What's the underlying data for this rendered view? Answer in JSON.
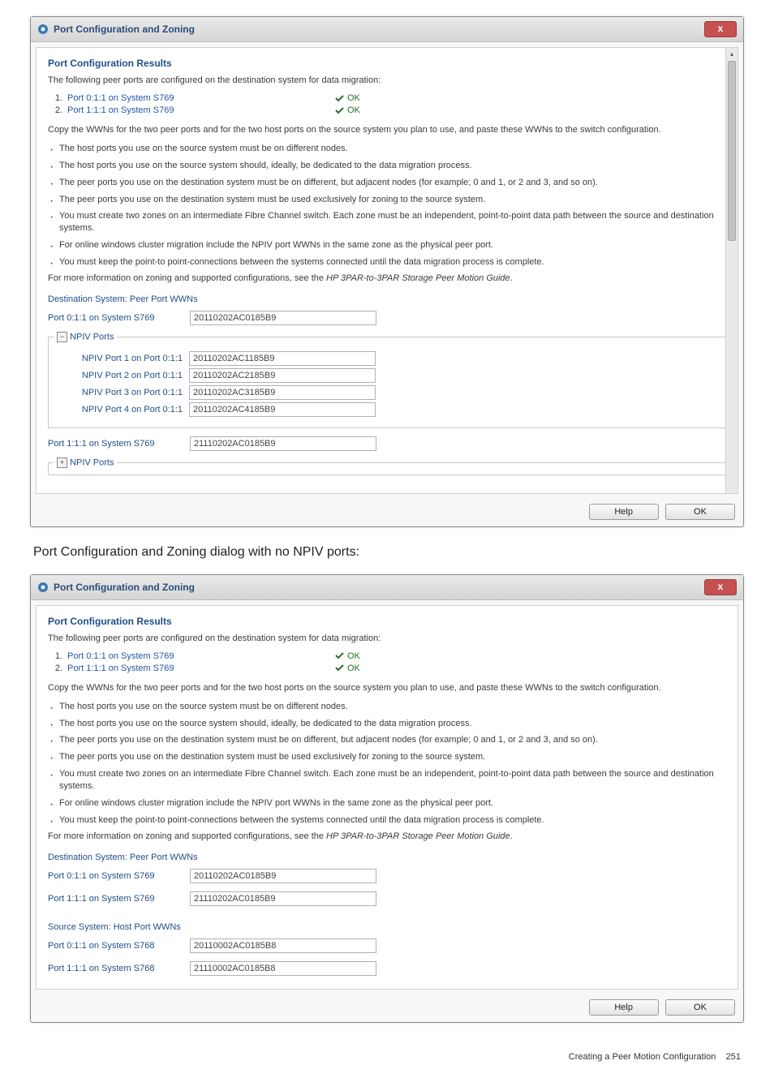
{
  "dialog_title": "Port Configuration and Zoning",
  "close_glyph": "x",
  "results_heading": "Port Configuration Results",
  "intro_line": "The following peer ports are configured on the destination system for data migration:",
  "port_results": [
    {
      "num": "1.",
      "label": "Port 0:1:1 on System S769",
      "status": "OK"
    },
    {
      "num": "2.",
      "label": "Port 1:1:1 on System S769",
      "status": "OK"
    }
  ],
  "copy_wwns_text_a": "Copy the WWNs for the two peer ports and for the two host ports on the source system you plan to use, and paste these WWNs to the switch configuration.",
  "copy_wwns_text_b": "Copy the WWNs for the two peer ports and for the two host ports on the source system you plan to use, and paste these WWNs to the switch configuration.",
  "bullets_common": [
    "The host ports you use on the source system must be on different nodes.",
    "The host ports you use on the source system should, ideally, be dedicated to the data migration process."
  ],
  "bullet_adjacent_a": "The peer ports you use on the destination system must be on different, but adjacent nodes (for example; 0 and 1, or 2 and 3, and so on).",
  "bullet_adjacent_b": "The peer ports you use on the destination system must be on different, but adjacent nodes (for example; 0 and 1, or 2 and 3, and so on).",
  "bullets_tail": [
    "The peer ports you use on the destination system must be used exclusively for zoning to the source system.",
    "You must create two zones on an intermediate Fibre Channel switch. Each zone must be an independent, point-to-point data path between the source and destination systems.",
    "For online windows cluster migration include the NPIV port WWNs in the same zone as the physical peer port."
  ],
  "bullet_keep_a": "You must keep the point-to point-connections between the systems connected until the data migration process is complete.",
  "bullet_keep_b": "You must keep the point-to point-connections between the systems connected until the data migration process is complete.",
  "more_info_prefix": "For more information on zoning and supported configurations, see the ",
  "more_info_doc": "HP 3PAR-to-3PAR Storage Peer Motion Guide",
  "more_info_suffix": ".",
  "dest_heading": "Destination System: Peer Port WWNs",
  "dest_ports": [
    {
      "label": "Port 0:1:1 on System S769",
      "value": "20110202AC0185B9"
    },
    {
      "label": "Port 1:1:1 on System S769",
      "value": "21110202AC0185B9"
    }
  ],
  "npiv_fieldset_legend": "NPIV Ports",
  "npiv_rows": [
    {
      "label": "NPIV Port 1 on Port 0:1:1",
      "value": "20110202AC1185B9"
    },
    {
      "label": "NPIV Port 2 on Port 0:1:1",
      "value": "20110202AC2185B9"
    },
    {
      "label": "NPIV Port 3 on Port 0:1:1",
      "value": "20110202AC3185B9"
    },
    {
      "label": "NPIV Port 4 on Port 0:1:1",
      "value": "20110202AC4185B9"
    }
  ],
  "npiv_collapsed_label": "NPIV Ports",
  "source_heading": "Source System: Host Port WWNs",
  "source_ports": [
    {
      "label": "Port 0:1:1 on System S768",
      "value": "20110002AC0185B8"
    },
    {
      "label": "Port 1:1:1 on System S768",
      "value": "21110002AC0185B8"
    }
  ],
  "buttons": {
    "help": "Help",
    "ok": "OK"
  },
  "between_caption": "Port Configuration and Zoning dialog with no NPIV ports:",
  "footer": {
    "section": "Creating a Peer Motion Configuration",
    "page": "251"
  }
}
